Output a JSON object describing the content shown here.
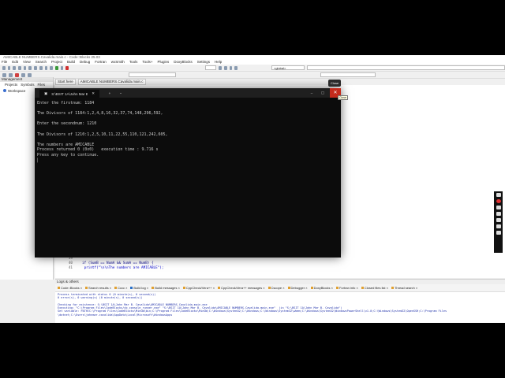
{
  "ide": {
    "title": "AMICABLE NUMBERS.Cavalida.main.c - Code::Blocks 25.03",
    "menu": [
      "File",
      "Edit",
      "View",
      "Search",
      "Project",
      "Build",
      "Debug",
      "Fortran",
      "wxSmith",
      "Tools",
      "Tools+",
      "Plugins",
      "DoxyBlocks",
      "Settings",
      "Help"
    ],
    "scope_combo": "<global>",
    "management": {
      "title": "Management",
      "tabs": [
        "Projects",
        "Symbols",
        "Files"
      ],
      "workspace": "Workspace"
    },
    "editor_tabs": [
      "Start here",
      "AMICABLE NUMBERS.Cavalida.main.c"
    ],
    "code": [
      {
        "ln": "39",
        "text": ""
      },
      {
        "ln": "40",
        "text": "if (SumB == NumA && SumA == NumB) {"
      },
      {
        "ln": "41",
        "text": "    printf(\"\\n\\nThe numbers are AMICABLE\");"
      }
    ],
    "logs": {
      "title": "Logs & others",
      "tabs": [
        "Code::Blocks",
        "Search results",
        "Cccc",
        "Build log",
        "Build messages",
        "CppCheck/Vera++",
        "CppCheck/Vera++ messages",
        "Cscope",
        "Debugger",
        "DoxyBlocks",
        "Fortran info",
        "Closed files list",
        "Thread search"
      ],
      "active_tab": "Build log",
      "lines": [
        "Process terminated with status 0 (0 minute(s), 0 second(s))",
        "0 error(s), 0 warning(s) (0 minute(s), 0 second(s))",
        "",
        "Checking for existence: S:\\BSIT 1A\\John Mar B. Cavalida\\AMICABLE NUMBERS.Cavalida.main.exe",
        "Executing: \"C:\\Program Files\\CodeBlocks/cb_console_runner.exe\" \"S:\\BSIT 1A\\John Mar B. Cavalida\\AMICABLE NUMBERS.Cavalida.main.exe\"  (in \"S:\\BSIT 1A\\John Mar B. Cavalida\")",
        "Set variable: PATH=C:\\Program Files\\CodeBlocks\\MinGW\\bin;C:\\Program Files\\CodeBlocks\\MinGW;C:\\Windows\\System32;C:\\Windows;C:\\Windows\\System32\\wbem;C:\\Windows\\System32\\WindowsPowerShell\\v1.0;C:\\Windows\\System32\\OpenSSH;C:\\Program Files",
        "\\dotnet;C:\\Users\\johnmar.cavalida\\AppData\\Local\\Microsoft\\WindowsApps"
      ]
    }
  },
  "console": {
    "tab_title": "S:\\BSIT 1A\\John Mar B. Caval",
    "close_tooltip": "Close",
    "close_hint": "Close",
    "lines": [
      "Enter the firstnum: 1184",
      "",
      "The Divisors of 1184:1,2,4,8,16,32,37,74,148,296,592,",
      "",
      "Enter the secondnum: 1210",
      "",
      "The Divisors of 1210:1,2,5,10,11,22,55,110,121,242,605,",
      "",
      "The numbers are AMICABLE",
      "Process returned 0 (0x0)   execution time : 9.716 s",
      "Press any key to continue."
    ]
  }
}
